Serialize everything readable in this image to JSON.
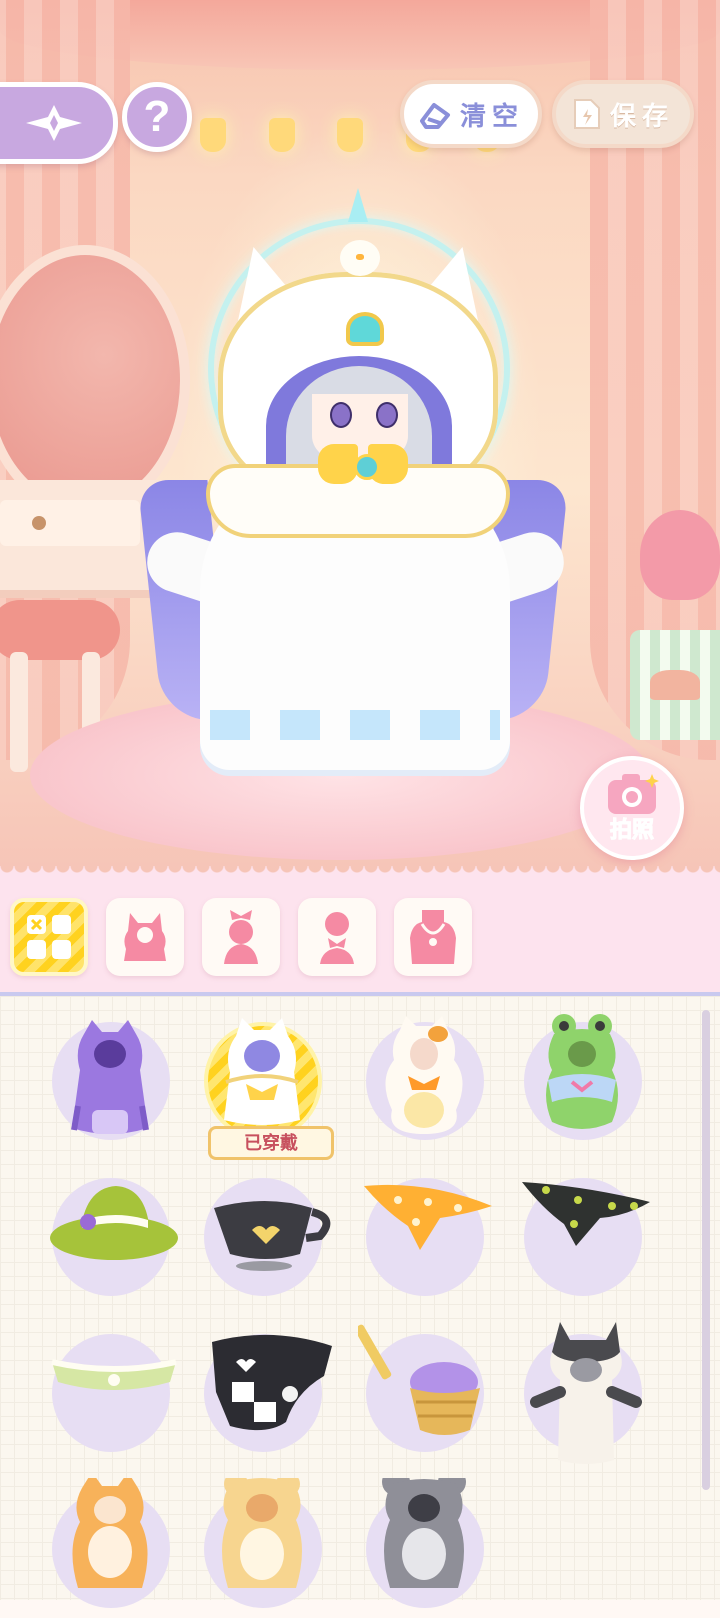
{
  "toolbar": {
    "clear_label": "清空",
    "save_label": "保存"
  },
  "help": {
    "label": "?"
  },
  "camera": {
    "label": "拍照"
  },
  "categories": [
    {
      "name": "all",
      "icon": "grid-icon",
      "active": true
    },
    {
      "name": "hooded-outfit",
      "icon": "hood-silhouette-icon",
      "active": false
    },
    {
      "name": "headwear",
      "icon": "bow-bust-icon",
      "active": false
    },
    {
      "name": "neck-accessory",
      "icon": "bust-accessory-icon",
      "active": false
    },
    {
      "name": "necklace",
      "icon": "necklace-icon",
      "active": false
    }
  ],
  "items": [
    {
      "id": "purple-ghost-cloak",
      "worn": false
    },
    {
      "id": "white-cat-mage-cloak",
      "worn": true,
      "worn_label": "已穿戴"
    },
    {
      "id": "calico-cat-suit",
      "worn": false
    },
    {
      "id": "frog-suit",
      "worn": false
    },
    {
      "id": "green-hat",
      "worn": false
    },
    {
      "id": "black-teacup-hat",
      "worn": false
    },
    {
      "id": "orange-polka-bandana",
      "worn": false
    },
    {
      "id": "black-polka-bandana",
      "worn": false
    },
    {
      "id": "gingham-collar",
      "worn": false
    },
    {
      "id": "black-patchwork-collar",
      "worn": false
    },
    {
      "id": "flower-basket",
      "worn": false
    },
    {
      "id": "black-cat-suit",
      "worn": false
    },
    {
      "id": "orange-cat-suit",
      "worn": false
    },
    {
      "id": "bear-suit",
      "worn": false
    },
    {
      "id": "gray-mouse-suit",
      "worn": false
    }
  ],
  "colors": {
    "accent_lavender": "#c8a8e0",
    "selected_yellow": "#ffd21f",
    "bubble": "#e7def3",
    "worn_text": "#c7505e"
  }
}
